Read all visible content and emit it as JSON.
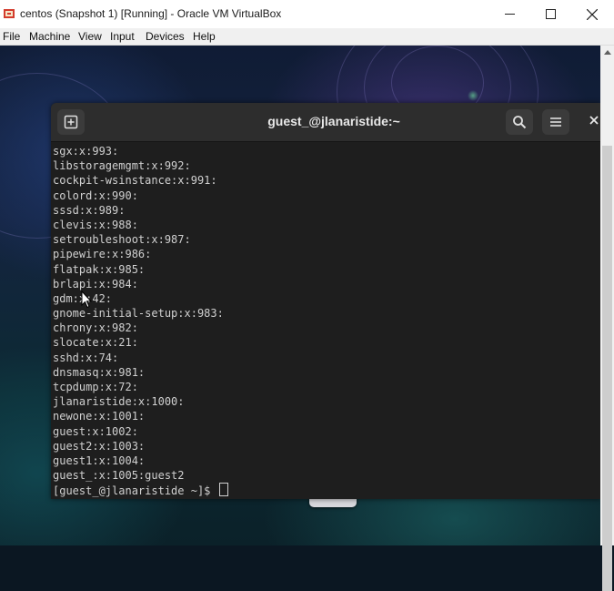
{
  "window": {
    "title": "centos (Snapshot 1) [Running] - Oracle VM VirtualBox",
    "menu": [
      "File",
      "Machine",
      "View",
      "Input",
      "Devices",
      "Help"
    ]
  },
  "terminal": {
    "title": "guest_@jlanaristide:~",
    "lines": [
      "sgx:x:993:",
      "libstoragemgmt:x:992:",
      "cockpit-wsinstance:x:991:",
      "colord:x:990:",
      "sssd:x:989:",
      "clevis:x:988:",
      "setroubleshoot:x:987:",
      "pipewire:x:986:",
      "flatpak:x:985:",
      "brlapi:x:984:",
      "gdm:x:42:",
      "gnome-initial-setup:x:983:",
      "chrony:x:982:",
      "slocate:x:21:",
      "sshd:x:74:",
      "dnsmasq:x:981:",
      "tcpdump:x:72:",
      "jlanaristide:x:1000:",
      "newone:x:1001:",
      "guest:x:1002:",
      "guest2:x:1003:",
      "guest1:x:1004:",
      "guest_:x:1005:guest2"
    ],
    "prompt": "[guest_@jlanaristide ~]$ "
  },
  "icons": {
    "app": "virtualbox-icon",
    "new_tab": "new-tab-icon",
    "search": "search-icon",
    "menu": "hamburger-menu-icon",
    "close": "close-icon",
    "dock": "terminal-app-icon"
  }
}
